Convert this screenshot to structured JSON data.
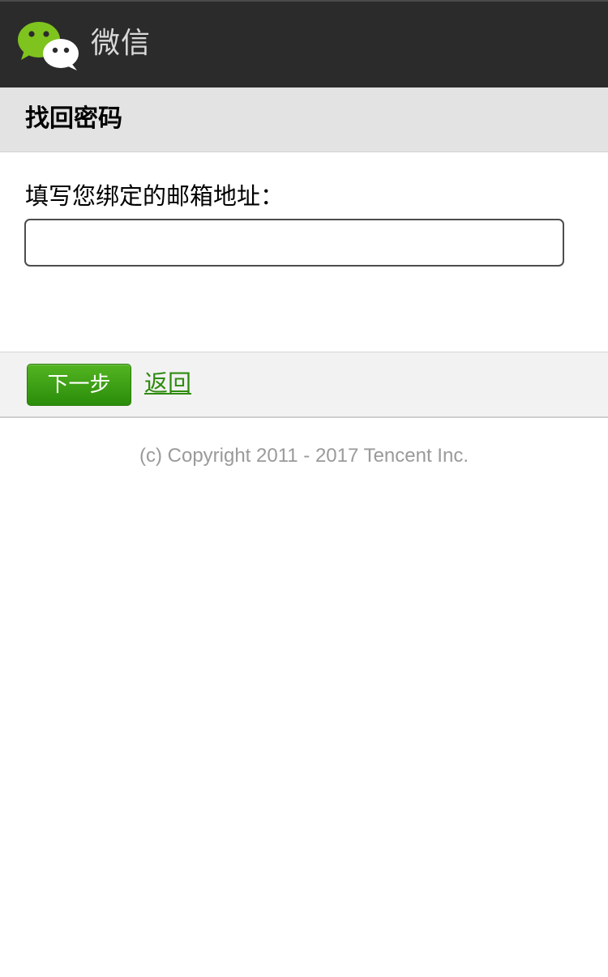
{
  "header": {
    "brand": "微信",
    "logo_icon": "wechat-logo-icon",
    "background": "#2b2b2b"
  },
  "page": {
    "title": "找回密码"
  },
  "form": {
    "email_label": "填写您绑定的邮箱地址：",
    "email_value": "",
    "email_placeholder": ""
  },
  "actions": {
    "next_label": "下一步",
    "back_label": "返回",
    "accent": "#2e8b0d"
  },
  "footer": {
    "copyright": "(c) Copyright 2011 - 2017 Tencent Inc."
  }
}
